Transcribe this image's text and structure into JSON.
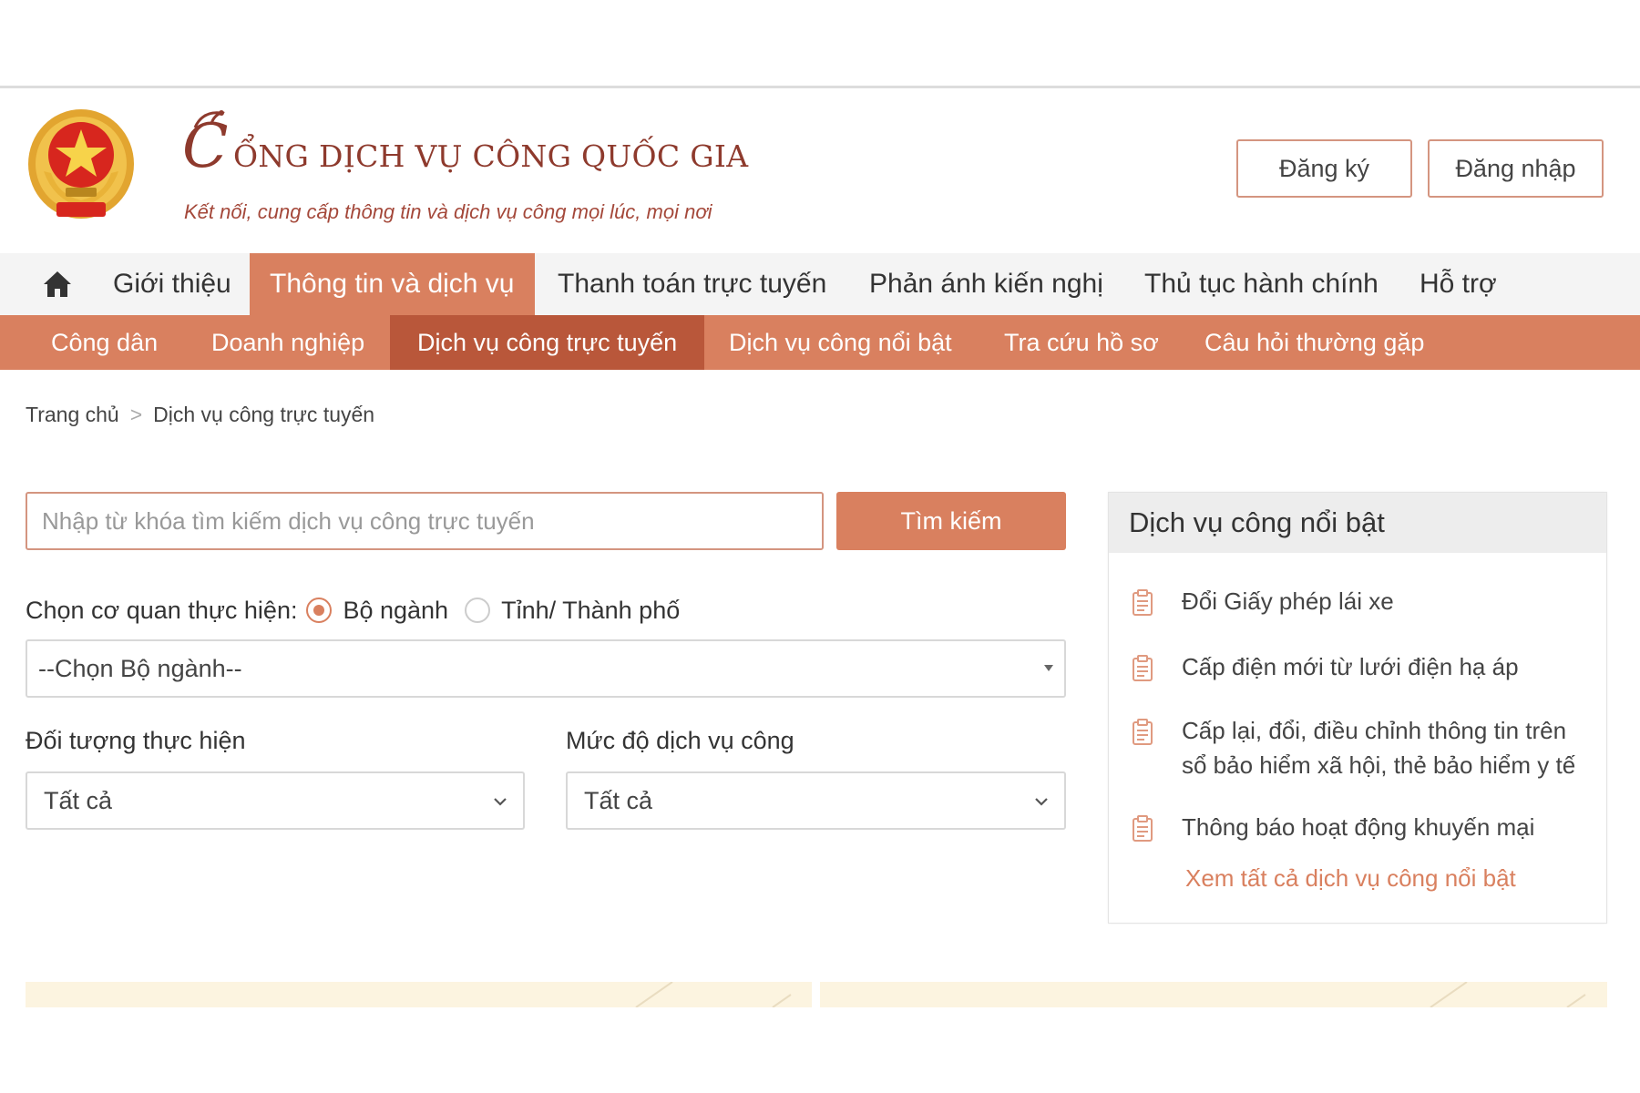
{
  "header": {
    "title_initial": "C",
    "title_rest": "ỔNG DỊCH VỤ CÔNG QUỐC GIA",
    "subtitle": "Kết nối, cung cấp thông tin và dịch vụ công mọi lúc, mọi nơi",
    "register_label": "Đăng ký",
    "login_label": "Đăng nhập",
    "emblem_icon": "national-emblem-icon"
  },
  "nav": {
    "home_icon": "home-icon",
    "items": [
      {
        "label": "Giới thiệu",
        "active": false
      },
      {
        "label": "Thông tin và dịch vụ",
        "active": true
      },
      {
        "label": "Thanh toán trực tuyến",
        "active": false
      },
      {
        "label": "Phản ánh kiến nghị",
        "active": false
      },
      {
        "label": "Thủ tục hành chính",
        "active": false
      },
      {
        "label": "Hỗ trợ",
        "active": false
      }
    ]
  },
  "subnav": {
    "items": [
      {
        "label": "Công dân",
        "active": false
      },
      {
        "label": "Doanh nghiệp",
        "active": false
      },
      {
        "label": "Dịch vụ công trực tuyến",
        "active": true
      },
      {
        "label": "Dịch vụ công nổi bật",
        "active": false
      },
      {
        "label": "Tra cứu hồ sơ",
        "active": false
      },
      {
        "label": "Câu hỏi thường gặp",
        "active": false
      }
    ]
  },
  "breadcrumb": {
    "home": "Trang chủ",
    "separator": ">",
    "current": "Dịch vụ công trực tuyến"
  },
  "search": {
    "placeholder": "Nhập từ khóa tìm kiếm dịch vụ công trực tuyến",
    "value": "",
    "button_label": "Tìm kiếm"
  },
  "agency": {
    "label": "Chọn cơ quan thực hiện:",
    "options": [
      {
        "label": "Bộ ngành",
        "checked": true
      },
      {
        "label": "Tỉnh/ Thành phố",
        "checked": false
      }
    ],
    "select_value": "--Chọn Bộ ngành--"
  },
  "filters": {
    "object_label": "Đối tượng thực hiện",
    "object_value": "Tất cả",
    "level_label": "Mức độ dịch vụ công",
    "level_value": "Tất cả"
  },
  "featured": {
    "title": "Dịch vụ công nổi bật",
    "items": [
      "Đổi Giấy phép lái xe",
      "Cấp điện mới từ lưới điện hạ áp",
      "Cấp lại, đổi, điều chỉnh thông tin trên sổ bảo hiểm xã hội, thẻ bảo hiểm y tế",
      "Thông báo hoạt động khuyến mại"
    ],
    "view_all": "Xem tất cả dịch vụ công nổi bật",
    "item_icon": "document-icon"
  },
  "colors": {
    "accent": "#d9805f",
    "accent_dark": "#b9573a",
    "brand_text": "#8e3a2d",
    "nav_bg": "#f4f4f4",
    "panel_head_bg": "#ededed",
    "banner_bg": "#fcf4e0"
  }
}
